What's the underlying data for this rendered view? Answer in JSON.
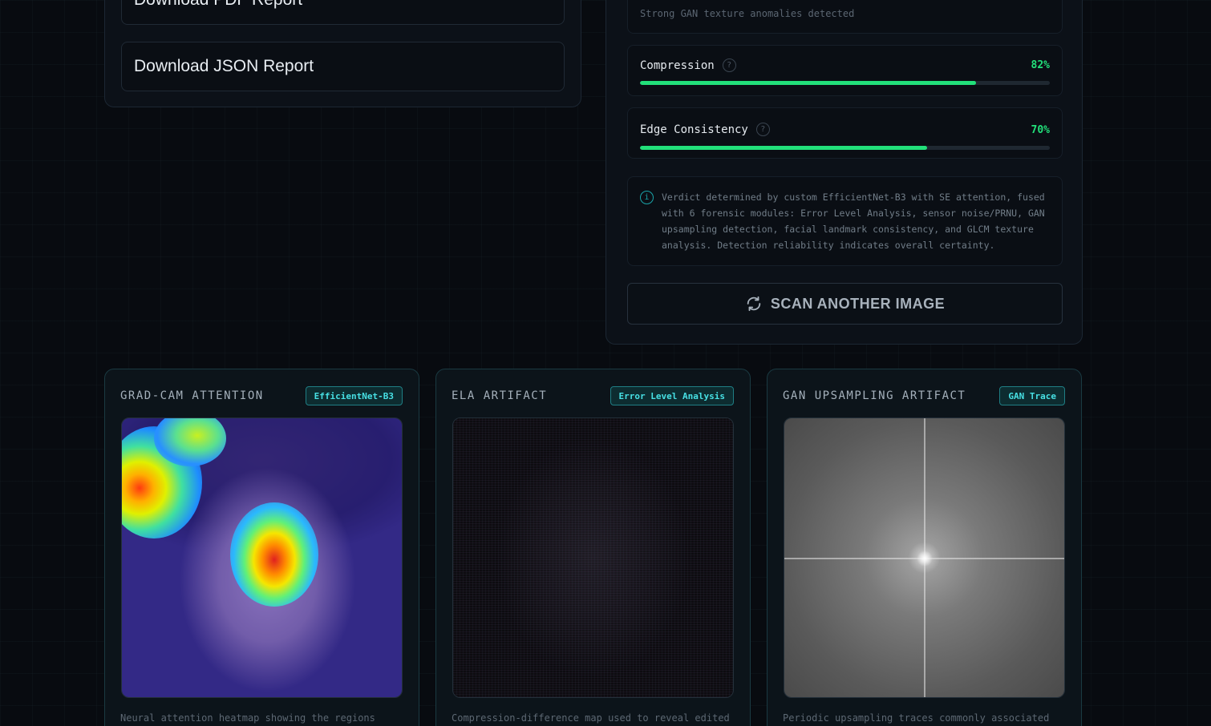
{
  "downloads": {
    "pdf_label": "Download PDF Report",
    "json_label": "Download JSON Report"
  },
  "results": {
    "texture_note": "Strong GAN texture anomalies detected",
    "metrics": [
      {
        "label": "Compression",
        "value_text": "82%",
        "value": 0.82,
        "help": "?"
      },
      {
        "label": "Edge Consistency",
        "value_text": "70%",
        "value": 0.7,
        "help": "?"
      }
    ],
    "info_icon": "i",
    "info_text": "Verdict determined by custom EfficientNet-B3 with SE attention, fused with 6 forensic modules: Error Level Analysis, sensor noise/PRNU, GAN upsampling detection, facial landmark consistency, and GLCM texture analysis. Detection reliability indicates overall certainty.",
    "scan_label": "SCAN ANOTHER IMAGE",
    "scan_icon": "refresh-icon"
  },
  "visualizations": [
    {
      "title": "GRAD-CAM ATTENTION",
      "badge": "EfficientNet-B3",
      "description": "Neural attention heatmap showing the regions most"
    },
    {
      "title": "ELA ARTIFACT",
      "badge": "Error Level Analysis",
      "description": "Compression-difference map used to reveal edited or"
    },
    {
      "title": "GAN UPSAMPLING ARTIFACT",
      "badge": "GAN Trace",
      "description": "Periodic upsampling traces commonly associated with"
    }
  ],
  "colors": {
    "accent_green": "#22e07a",
    "accent_cyan": "#47e0e4",
    "background": "#080b10"
  }
}
